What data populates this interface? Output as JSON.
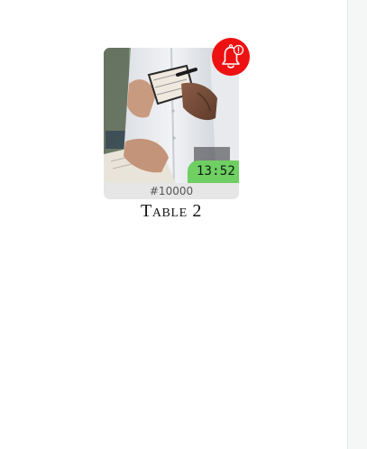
{
  "table": {
    "time": "13:52",
    "order_number": "#10000",
    "name": "Table 2"
  },
  "icons": {
    "alert": "bell-alert-icon"
  },
  "colors": {
    "alert_bg": "#ee1111",
    "time_badge_bg": "#6fcf63",
    "order_bar_bg": "#e6e6e6",
    "right_rail_bg": "#f5f6f6"
  }
}
